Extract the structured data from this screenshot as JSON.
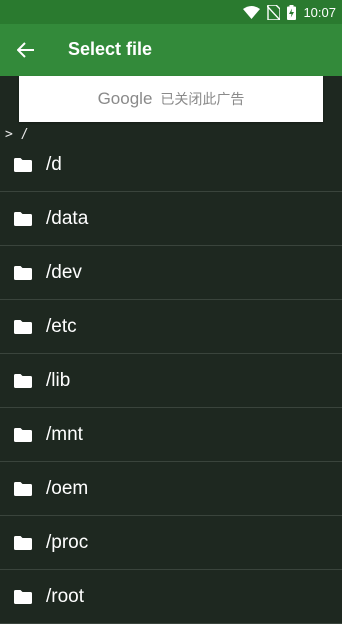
{
  "status_bar": {
    "time": "10:07",
    "icons": [
      "wifi-icon",
      "no-sim-icon",
      "battery-charging-icon"
    ]
  },
  "app_bar": {
    "title": "Select file",
    "back_icon": "arrow-back-icon"
  },
  "ad_banner": {
    "brand": "Google",
    "text": "已关闭此广告"
  },
  "current_path": "> /",
  "files": [
    {
      "name": "/d",
      "icon": "folder-icon"
    },
    {
      "name": "/data",
      "icon": "folder-icon"
    },
    {
      "name": "/dev",
      "icon": "folder-icon"
    },
    {
      "name": "/etc",
      "icon": "folder-icon"
    },
    {
      "name": "/lib",
      "icon": "folder-icon"
    },
    {
      "name": "/mnt",
      "icon": "folder-icon"
    },
    {
      "name": "/oem",
      "icon": "folder-icon"
    },
    {
      "name": "/proc",
      "icon": "folder-icon"
    },
    {
      "name": "/root",
      "icon": "folder-icon"
    }
  ],
  "colors": {
    "status_bar": "#2a7a2f",
    "app_bar": "#338a3a",
    "background": "#1e2820",
    "divider": "#3a443c"
  }
}
